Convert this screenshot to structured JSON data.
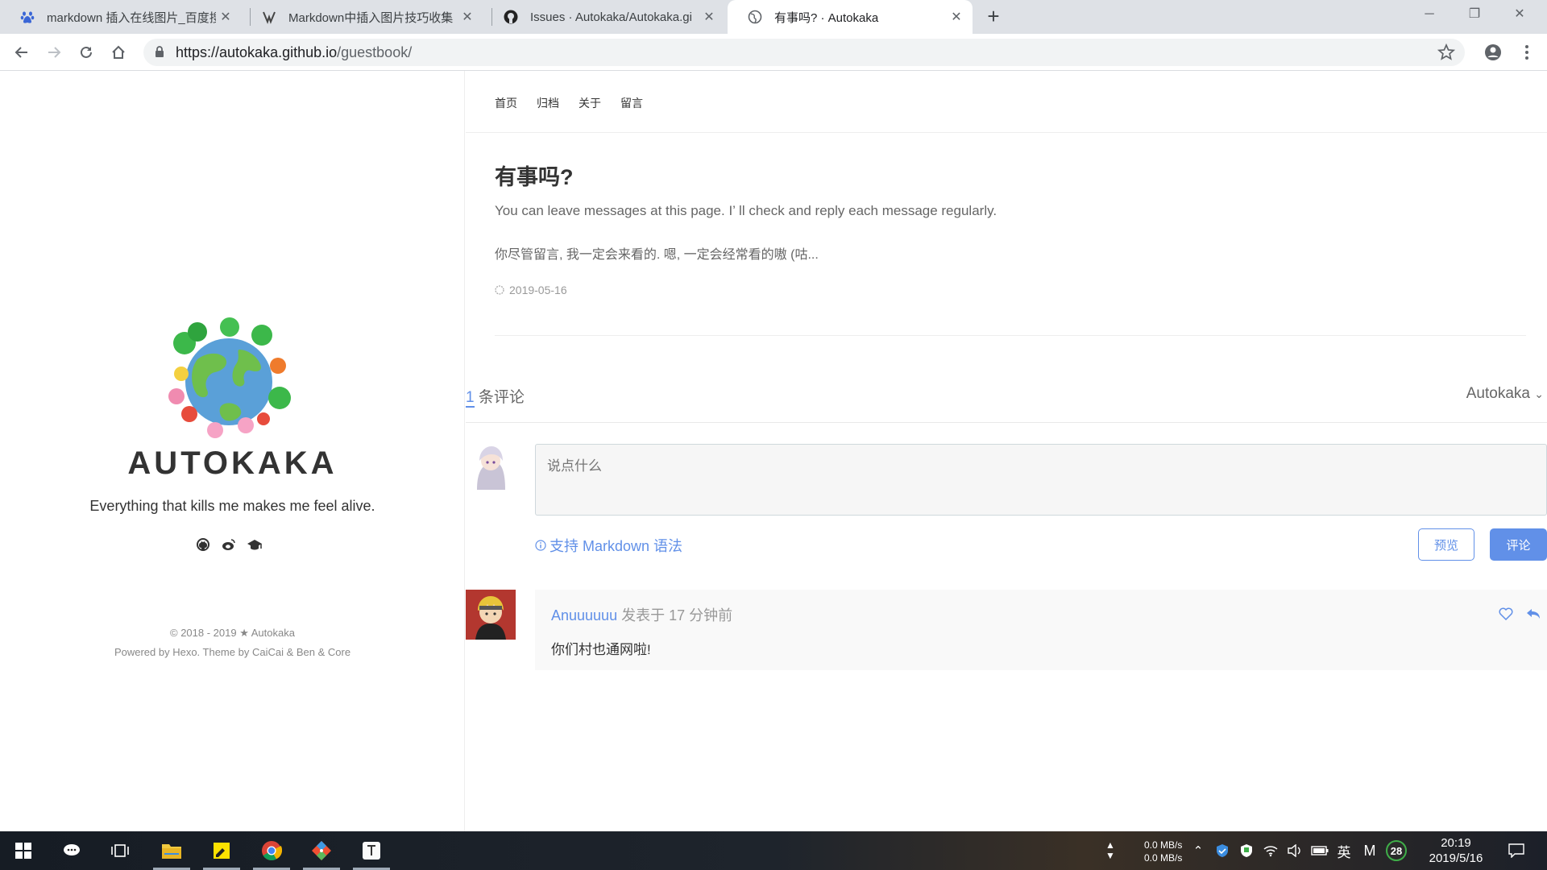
{
  "browser": {
    "tabs": [
      {
        "title": "markdown 插入在线图片_百度搜",
        "icon": "baidu-paw-icon"
      },
      {
        "title": "Markdown中插入图片技巧收集",
        "icon": "csdn-icon"
      },
      {
        "title": "Issues · Autokaka/Autokaka.gi",
        "icon": "github-icon"
      },
      {
        "title": "有事吗? · Autokaka",
        "icon": "globe-icon"
      }
    ],
    "url_host": "https://autokaka.github.io",
    "url_path": "/guestbook/"
  },
  "sidebar": {
    "title": "AUTOKAKA",
    "subtitle": "Everything that kills me makes me feel alive.",
    "social_icons": [
      "github-icon",
      "weibo-icon",
      "scholar-cap-icon"
    ],
    "footer_copyright": "© 2018 - 2019 ★ Autokaka",
    "footer_powered": "Powered by Hexo. Theme by CaiCai & Ben & Core"
  },
  "nav": [
    "首页",
    "归档",
    "关于",
    "留言"
  ],
  "post": {
    "title": "有事吗?",
    "intro_en": "You can leave messages at this page. I’ ll check and reply each message regularly.",
    "intro_zh": "你尽管留言, 我一定会来看的. 嗯, 一定会经常看的嗷 (咕...",
    "date": "2019-05-16"
  },
  "comments": {
    "count": "1",
    "count_label": " 条评论",
    "user": "Autokaka",
    "placeholder": "说点什么",
    "markdown_tip": "支持 Markdown 语法",
    "preview_label": "预览",
    "submit_label": "评论",
    "items": [
      {
        "author": "Anuuuuuu",
        "meta": " 发表于 17 分钟前",
        "body": "你们村也通网啦!"
      }
    ]
  },
  "taskbar": {
    "net_up": "0.0 MB/s",
    "net_down": "0.0 MB/s",
    "ime": "英",
    "m_label": "M",
    "badge": "28",
    "time": "20:19",
    "date": "2019/5/16"
  },
  "colors": {
    "accent": "#6190e8",
    "tabbar": "#dee1e6"
  }
}
